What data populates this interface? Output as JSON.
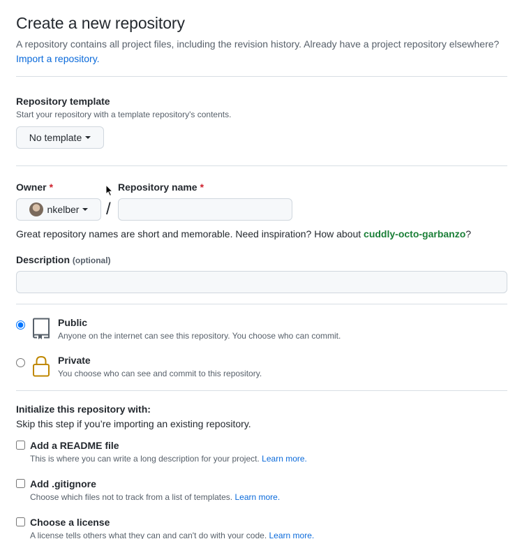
{
  "header": {
    "title": "Create a new repository",
    "intro_text": "A repository contains all project files, including the revision history. Already have a project repository elsewhere?",
    "import_link": "Import a repository."
  },
  "template": {
    "label": "Repository template",
    "note": "Start your repository with a template repository's contents.",
    "button_label": "No template"
  },
  "owner": {
    "label": "Owner",
    "required_mark": "*",
    "value": "nkelber"
  },
  "repo_name": {
    "label": "Repository name",
    "required_mark": "*",
    "value": "",
    "separator": "/"
  },
  "hint": {
    "prefix": "Great repository names are short and memorable. Need inspiration? How about ",
    "suggestion": "cuddly-octo-garbanzo",
    "suffix": "?"
  },
  "description": {
    "label": "Description",
    "optional": "(optional)",
    "value": ""
  },
  "visibility": {
    "selected": "public",
    "options": [
      {
        "id": "public",
        "title": "Public",
        "desc": "Anyone on the internet can see this repository. You choose who can commit.",
        "icon": "repo-icon"
      },
      {
        "id": "private",
        "title": "Private",
        "desc": "You choose who can see and commit to this repository.",
        "icon": "lock-icon"
      }
    ]
  },
  "init": {
    "heading": "Initialize this repository with:",
    "subheading": "Skip this step if you’re importing an existing repository.",
    "options": [
      {
        "title": "Add a README file",
        "desc": "This is where you can write a long description for your project.",
        "link": "Learn more."
      },
      {
        "title": "Add .gitignore",
        "desc": "Choose which files not to track from a list of templates.",
        "link": "Learn more."
      },
      {
        "title": "Choose a license",
        "desc": "A license tells others what they can and can't do with your code.",
        "link": "Learn more."
      }
    ]
  },
  "colors": {
    "link": "#0969da",
    "required": "#cf222e",
    "suggestion": "#1a7f37",
    "private_icon": "#bf8700"
  }
}
